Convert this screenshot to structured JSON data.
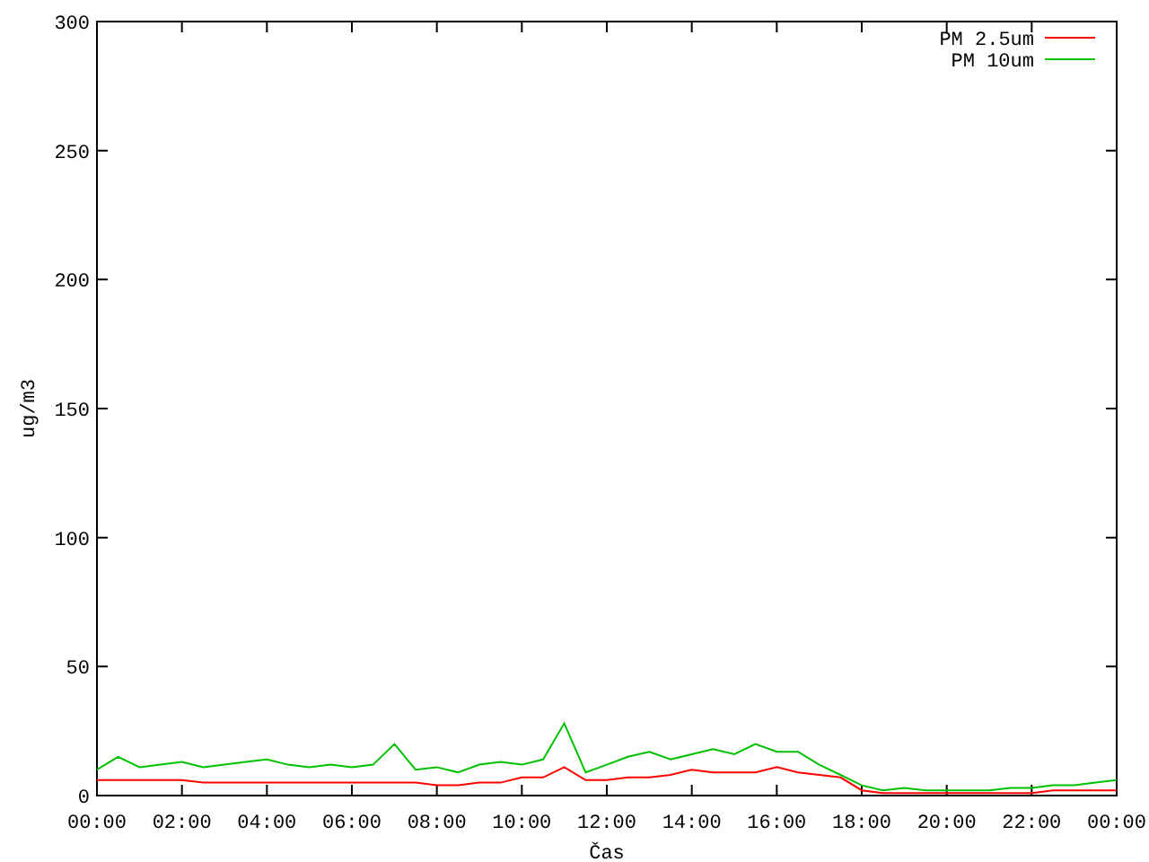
{
  "chart": {
    "chart_data": {
      "type": "line",
      "xlabel": "Čas",
      "ylabel": "ug/m3",
      "x": [
        0,
        0.5,
        1,
        1.5,
        2,
        2.5,
        3,
        3.5,
        4,
        4.5,
        5,
        5.5,
        6,
        6.5,
        7,
        7.5,
        8,
        8.5,
        9,
        9.5,
        10,
        10.5,
        11,
        11.5,
        12,
        12.5,
        13,
        13.5,
        14,
        14.5,
        15,
        15.5,
        16,
        16.5,
        17,
        17.5,
        18,
        18.5,
        19,
        19.5,
        20,
        20.5,
        21,
        21.5,
        22,
        22.5,
        23,
        23.5,
        24
      ],
      "series": [
        {
          "name": "PM 2.5um",
          "color": "#ff0000",
          "values": [
            6,
            6,
            6,
            6,
            6,
            5,
            5,
            5,
            5,
            5,
            5,
            5,
            5,
            5,
            5,
            5,
            4,
            4,
            5,
            5,
            7,
            7,
            11,
            6,
            6,
            7,
            7,
            8,
            10,
            9,
            9,
            9,
            11,
            9,
            8,
            7,
            2,
            1,
            1,
            1,
            1,
            1,
            1,
            1,
            1,
            2,
            2,
            2,
            2
          ]
        },
        {
          "name": "PM 10um",
          "color": "#00c000",
          "values": [
            10,
            15,
            11,
            12,
            13,
            11,
            12,
            13,
            14,
            12,
            11,
            12,
            11,
            12,
            20,
            10,
            11,
            9,
            12,
            13,
            12,
            14,
            28,
            9,
            12,
            15,
            17,
            14,
            16,
            18,
            16,
            20,
            17,
            17,
            12,
            8,
            4,
            2,
            3,
            2,
            2,
            2,
            2,
            3,
            3,
            4,
            4,
            5,
            6
          ]
        }
      ],
      "xlim": [
        0,
        24
      ],
      "ylim": [
        0,
        300
      ],
      "xticks": [
        {
          "value": 0,
          "label": "00:00"
        },
        {
          "value": 2,
          "label": "02:00"
        },
        {
          "value": 4,
          "label": "04:00"
        },
        {
          "value": 6,
          "label": "06:00"
        },
        {
          "value": 8,
          "label": "08:00"
        },
        {
          "value": 10,
          "label": "10:00"
        },
        {
          "value": 12,
          "label": "12:00"
        },
        {
          "value": 14,
          "label": "14:00"
        },
        {
          "value": 16,
          "label": "16:00"
        },
        {
          "value": 18,
          "label": "18:00"
        },
        {
          "value": 20,
          "label": "20:00"
        },
        {
          "value": 22,
          "label": "22:00"
        },
        {
          "value": 24,
          "label": "00:00"
        }
      ],
      "yticks": [
        0,
        50,
        100,
        150,
        200,
        250,
        300
      ],
      "legend": true
    }
  }
}
